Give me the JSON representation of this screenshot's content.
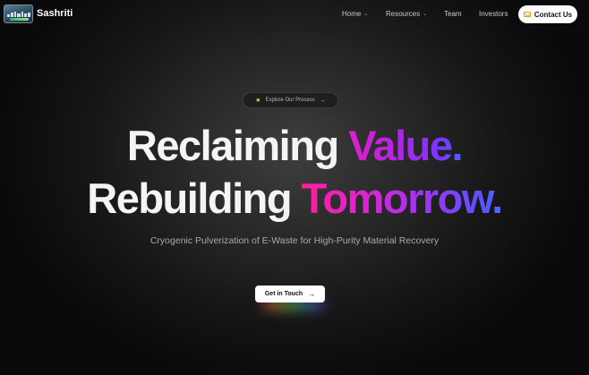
{
  "brand": {
    "name": "Sashriti",
    "logo_icon": "sashriti-logo"
  },
  "nav": {
    "items": [
      {
        "label": "Home",
        "has_dropdown": true
      },
      {
        "label": "Resources",
        "has_dropdown": true
      },
      {
        "label": "Team",
        "has_dropdown": false
      },
      {
        "label": "Investors",
        "has_dropdown": false
      }
    ],
    "dropdown_icon": "⌄",
    "contact_label": "Contact Us",
    "contact_icon": "mail-icon"
  },
  "hero": {
    "pill_label": "Explore Our Process",
    "pill_icon": "★",
    "pill_arrow": "→",
    "line1_plain": "Reclaiming ",
    "line1_accent": "Value.",
    "line2_plain": "Rebuilding ",
    "line2_accent": "Tomorrow.",
    "subtitle": "Cryogenic Pulverization of E-Waste for High-Purity Material Recovery",
    "cta_label": "Get in Touch",
    "cta_arrow": "→"
  },
  "colors": {
    "background": "#0b0b0b",
    "accent_pink": "#e01fc8",
    "accent_blue": "#4f5cff",
    "star": "#f2c44a"
  }
}
